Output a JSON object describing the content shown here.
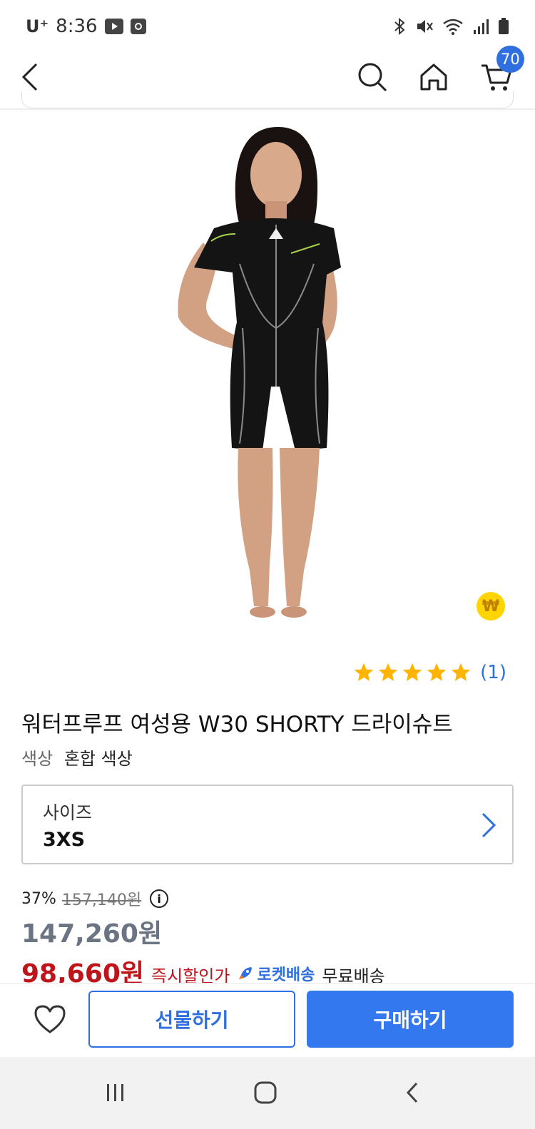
{
  "status_bar": {
    "carrier": "U⁺",
    "time": "8:36"
  },
  "header": {
    "cart_count": "70"
  },
  "product": {
    "title": "워터프루프 여성용 W30 SHORTY 드라이슈트",
    "color_label": "색상",
    "color_value": "혼합 색상",
    "rating": 5,
    "review_count": "(1)",
    "won_badge": "₩"
  },
  "size_option": {
    "label": "사이즈",
    "value": "3XS"
  },
  "price": {
    "discount_rate": "37%",
    "original": "157,140원",
    "sale": "147,260원",
    "final": "98,660원",
    "instant_discount_label": "즉시할인가",
    "rocket_label": "로켓배송",
    "shipping": "무료배송"
  },
  "actions": {
    "gift_label": "선물하기",
    "buy_label": "구매하기"
  },
  "colors": {
    "accent": "#2f6fe0",
    "buy_button": "#3478f0",
    "final_price": "#c0141b",
    "star": "#ffb400"
  }
}
